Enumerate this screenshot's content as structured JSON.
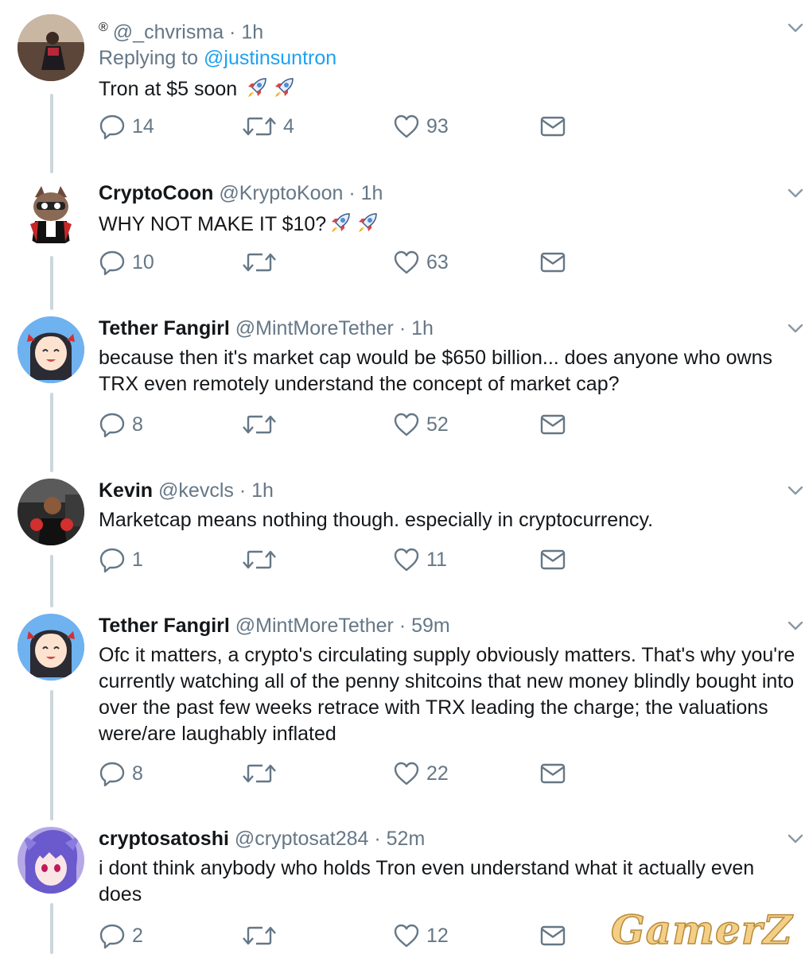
{
  "colors": {
    "text": "#14171a",
    "muted": "#657786",
    "link": "#1da1f2",
    "thread_line": "#ccd6dd"
  },
  "tweets": [
    {
      "badge": "®",
      "name": "",
      "handle": "@_chvrisma",
      "time": "1h",
      "replying_label": "Replying to",
      "replying_to": "@justinsuntron",
      "text": "Tron at $5 soon",
      "emoji": [
        "rocket",
        "rocket"
      ],
      "replies": "14",
      "retweets": "4",
      "likes": "93"
    },
    {
      "name": "CryptoCoon",
      "handle": "@KryptoKoon",
      "time": "1h",
      "text": "WHY NOT MAKE IT $10?",
      "emoji": [
        "rocket",
        "rocket"
      ],
      "replies": "10",
      "retweets": "",
      "likes": "63"
    },
    {
      "name": "Tether Fangirl",
      "handle": "@MintMoreTether",
      "time": "1h",
      "text": "because then it's market cap would be $650 billion... does anyone who owns TRX even remotely understand the concept of market cap?",
      "replies": "8",
      "retweets": "",
      "likes": "52"
    },
    {
      "name": "Kevin",
      "handle": "@kevcls",
      "time": "1h",
      "text": "Marketcap means nothing though. especially in cryptocurrency.",
      "replies": "1",
      "retweets": "",
      "likes": "11"
    },
    {
      "name": "Tether Fangirl",
      "handle": "@MintMoreTether",
      "time": "59m",
      "text": "Ofc it matters, a crypto's circulating supply obviously matters. That's why you're currently watching all of the penny shitcoins that new money blindly bought into over the past few weeks retrace with TRX leading the charge; the valuations were/are laughably inflated",
      "replies": "8",
      "retweets": "",
      "likes": "22"
    },
    {
      "name": "cryptosatoshi",
      "handle": "@cryptosat284",
      "time": "52m",
      "text": "i dont think anybody who holds Tron even understand what it actually even does",
      "replies": "2",
      "retweets": "",
      "likes": "12"
    }
  ],
  "separator": "·",
  "watermark": "GamerZ"
}
